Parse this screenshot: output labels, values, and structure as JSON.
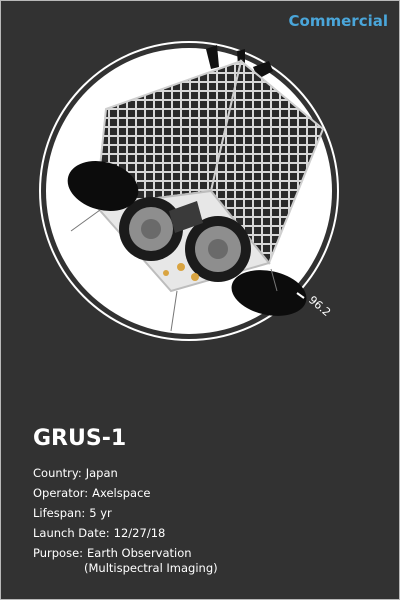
{
  "card": {
    "category": "Commercial",
    "orbit_inclination_label": "96.2",
    "name": "GRUS-1",
    "details": {
      "country_label": "Country:",
      "country": "Japan",
      "operator_label": "Operator:",
      "operator": "Axelspace",
      "lifespan_label": "Lifespan:",
      "lifespan": "5 yr",
      "launch_label": "Launch Date:",
      "launch_date": "12/27/18",
      "purpose_label": "Purpose:",
      "purpose_line1": "Earth Observation",
      "purpose_line2": "(Multispectral Imaging)"
    }
  },
  "colors": {
    "background": "#323232",
    "category": "#4aa6da",
    "text": "#ffffff",
    "circle": "#ffffff"
  }
}
